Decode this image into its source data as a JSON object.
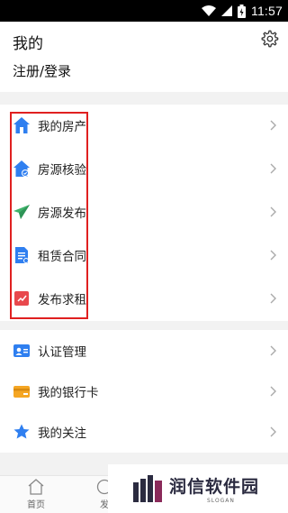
{
  "status_bar": {
    "time": "11:57"
  },
  "header": {
    "title": "我的",
    "login_text": "注册/登录"
  },
  "section1": {
    "items": [
      {
        "label": "我的房产",
        "icon": "house-icon",
        "color": "#2f7ff0"
      },
      {
        "label": "房源核验",
        "icon": "house-check-icon",
        "color": "#2f7ff0"
      },
      {
        "label": "房源发布",
        "icon": "paper-plane-icon",
        "color": "#3fb36b"
      },
      {
        "label": "租赁合同",
        "icon": "contract-icon",
        "color": "#2f7ff0"
      },
      {
        "label": "发布求租",
        "icon": "rent-request-icon",
        "color": "#e8484d"
      }
    ]
  },
  "section2": {
    "items": [
      {
        "label": "认证管理",
        "icon": "id-card-icon",
        "color": "#2f7ff0"
      },
      {
        "label": "我的银行卡",
        "icon": "bank-card-icon",
        "color": "#f5a623"
      },
      {
        "label": "我的关注",
        "icon": "star-icon",
        "color": "#2f7ff0"
      }
    ]
  },
  "tabbar": {
    "items": [
      {
        "label": "首页"
      },
      {
        "label": "发"
      }
    ]
  },
  "watermark": {
    "text": "润信软件园",
    "sub": "SLOGAN"
  }
}
